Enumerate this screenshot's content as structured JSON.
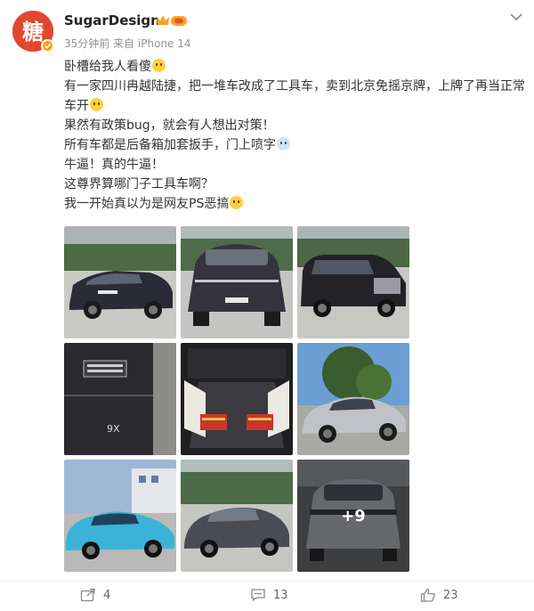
{
  "user": {
    "name": "SugarDesign",
    "avatar_text": "糖",
    "meta": "35分钟前  来自 iPhone 14"
  },
  "post": {
    "lines": [
      "卧槽给我人看傻",
      "有一家四川冉越陆捷，把一堆车改成了工具车，卖到北京免摇京牌，上牌了再当正常车开",
      "果然有政策bug，就会有人想出对策！",
      "所有车都是后备箱加套扳手，门上喷字",
      "牛逼！真的牛逼！",
      "这尊界算哪门子工具车啊？",
      "我一开始真以为是网友PS恶搞"
    ]
  },
  "photos": {
    "more_count": "+9",
    "car_badge": "9X"
  },
  "actions": {
    "repost_count": "4",
    "comment_count": "13",
    "like_count": "23"
  },
  "colors": {
    "accent": "#e2472e",
    "vip": "#ffa000",
    "meta_text": "#939393"
  },
  "icons": [
    "chevron-down-icon",
    "share-icon",
    "comment-icon",
    "like-icon",
    "verified-icon",
    "crown-icon"
  ]
}
